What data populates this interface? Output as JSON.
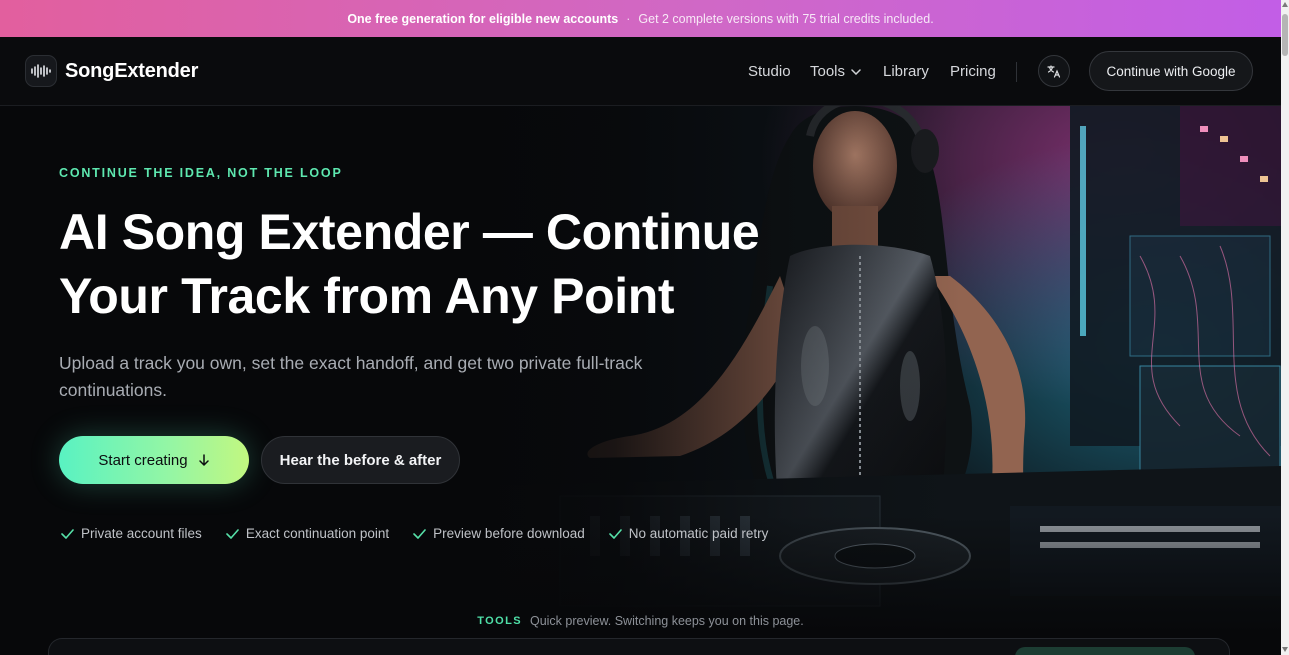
{
  "banner": {
    "strong": "One free generation for eligible new accounts",
    "separator": "·",
    "light": "Get 2 complete versions with 75 trial credits included."
  },
  "nav": {
    "brand": "SongExtender",
    "logo_icon": "waveform-icon",
    "links": {
      "studio": "Studio",
      "tools": "Tools",
      "library": "Library",
      "pricing": "Pricing"
    },
    "language_icon": "translate-icon",
    "signin": "Continue with Google"
  },
  "hero": {
    "eyebrow": "CONTINUE THE IDEA, NOT THE LOOP",
    "title_line1": "AI Song Extender — Continue",
    "title_line2": "Your Track from Any Point",
    "subtitle": "Upload a track you own, set the exact handoff, and get two private full-track continuations.",
    "primary_cta": "Start creating",
    "secondary_cta": "Hear the before & after",
    "checks": [
      "Private account files",
      "Exact continuation point",
      "Preview before download",
      "No automatic paid retry"
    ]
  },
  "tools_strip": {
    "tag": "TOOLS",
    "note": "Quick preview. Switching keeps you on this page."
  },
  "colors": {
    "accent": "#5ee8b0",
    "banner_start": "#e25f9e",
    "banner_end": "#c25ee6",
    "background": "#07080a"
  }
}
